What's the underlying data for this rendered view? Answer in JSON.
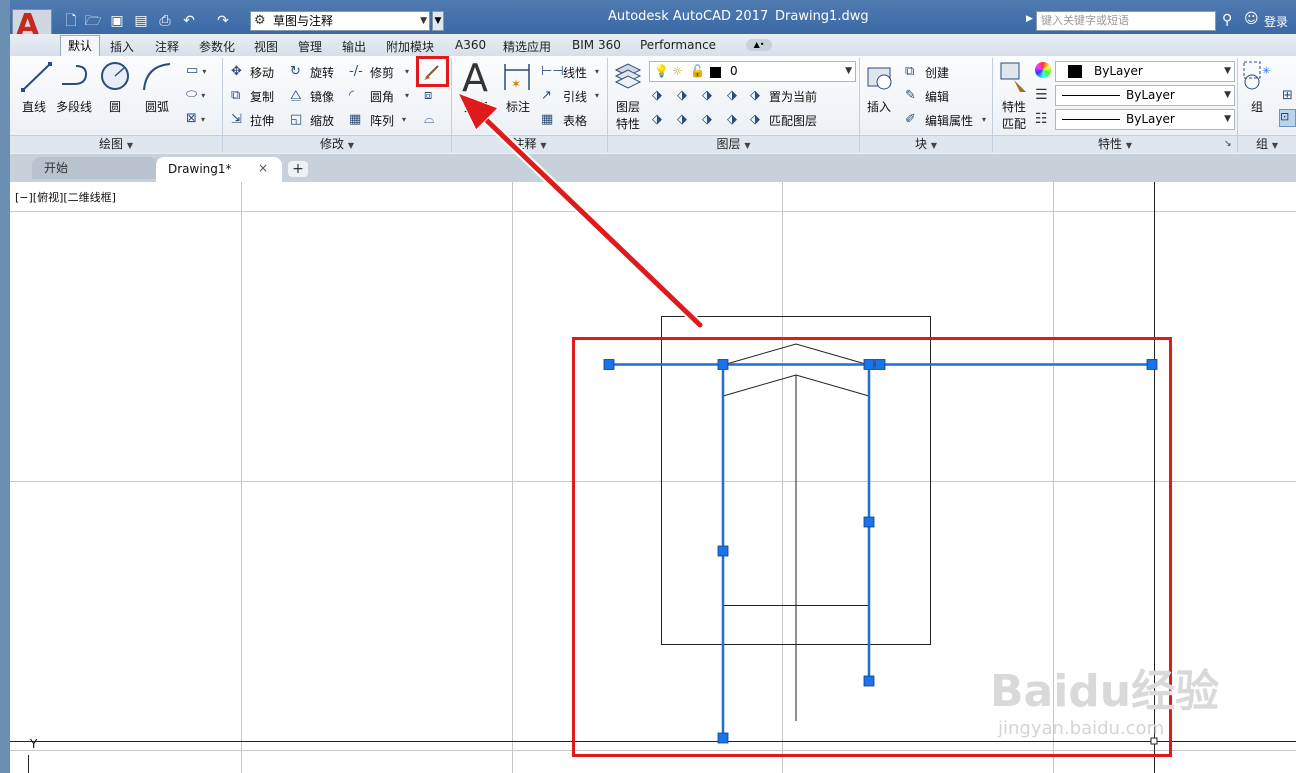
{
  "window": {
    "app_title": "Autodesk AutoCAD 2017",
    "doc_title": "Drawing1.dwg"
  },
  "quick_access": {
    "workspace": "草图与注释",
    "icons": [
      "new-icon",
      "open-icon",
      "save-icon",
      "saveas-icon",
      "print-icon",
      "undo-icon",
      "redo-icon"
    ]
  },
  "search": {
    "placeholder": "键入关键字或短语",
    "login": "登录"
  },
  "ribbon_tabs": [
    "默认",
    "插入",
    "注释",
    "参数化",
    "视图",
    "管理",
    "输出",
    "附加模块",
    "A360",
    "精选应用",
    "BIM 360",
    "Performance"
  ],
  "ribbon": {
    "draw": {
      "line": "直线",
      "polyline": "多段线",
      "circle": "圆",
      "arc": "圆弧",
      "footer": "绘图"
    },
    "modify": {
      "move": "移动",
      "rotate": "旋转",
      "trim": "修剪",
      "copy": "复制",
      "mirror": "镜像",
      "fillet": "圆角",
      "stretch": "拉伸",
      "scale": "缩放",
      "array": "阵列",
      "footer": "修改"
    },
    "annotation": {
      "text_letter": "A",
      "text_label": "文字",
      "dimension": "标注",
      "linear": "线性",
      "leader": "引线",
      "table": "表格",
      "footer": "注释"
    },
    "layers": {
      "current_layer": "0",
      "properties_line1": "图层",
      "properties_line2": "特性",
      "set_current": "置为当前",
      "match_layer": "匹配图层",
      "footer": "图层"
    },
    "block": {
      "insert": "插入",
      "create": "创建",
      "edit": "编辑",
      "edit_attr": "编辑属性",
      "footer": "块"
    },
    "properties": {
      "match_line1": "特性",
      "match_line2": "匹配",
      "color": "ByLayer",
      "linetype": "ByLayer",
      "lineweight": "ByLayer",
      "footer": "特性"
    },
    "groups": {
      "group": "组",
      "footer": "组"
    }
  },
  "file_tabs": {
    "start": "开始",
    "drawing": "Drawing1*",
    "close": "×",
    "add": "+"
  },
  "viewport": {
    "label": "[−][俯视][二维线框]",
    "axis_y": "Y"
  },
  "watermark": {
    "brand": "Baidu经验",
    "url": "jingyan.baidu.com"
  },
  "colors": {
    "highlight_red": "#e0191b",
    "selection_blue": "#1f6fd6",
    "grip_blue": "#1a73e8"
  }
}
